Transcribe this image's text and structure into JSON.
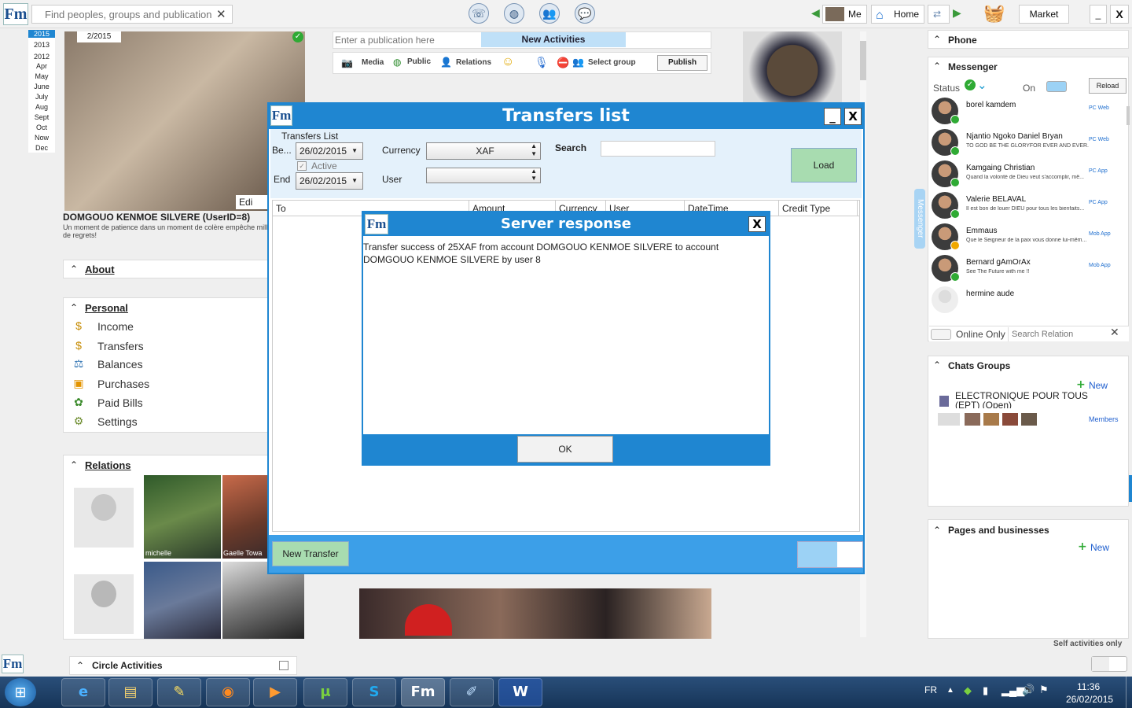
{
  "topbar": {
    "search_placeholder": "Find peoples, groups and publications",
    "search_clear": "✕",
    "me_label": "Me",
    "home_label": "Home",
    "market_label": "Market",
    "min_label": "_",
    "close_label": "X"
  },
  "timeline": {
    "years": [
      "2015",
      "2013",
      "2012"
    ],
    "months": [
      "Apr",
      "May",
      "June",
      "July",
      "Aug",
      "Sept",
      "Oct",
      "Now",
      "Dec"
    ]
  },
  "profile": {
    "date": "2/2015",
    "edit_label": "Edi",
    "name": "DOMGOUO KENMOE SILVERE (UserID=8)",
    "motto": "Un moment de patience dans un moment de colère empêche mill de regrets!",
    "about_label": "About",
    "personal_label": "Personal",
    "menu": [
      {
        "label": "Income",
        "icon": "dollar-coins-icon"
      },
      {
        "label": "Transfers",
        "icon": "dollar-transfer-icon"
      },
      {
        "label": "Balances",
        "icon": "scale-icon"
      },
      {
        "label": "Purchases",
        "icon": "basket-icon"
      },
      {
        "label": "Paid Bills",
        "icon": "bills-icon"
      },
      {
        "label": "Settings",
        "icon": "settings-icon"
      }
    ],
    "relations_label": "Relations",
    "relations": [
      "michelle",
      "Gaelle Towa"
    ]
  },
  "publish": {
    "placeholder": "Enter a publication here",
    "new_activities": "New Activities",
    "media": "Media",
    "public": "Public",
    "relations": "Relations",
    "select_group": "Select group",
    "publish": "Publish"
  },
  "transfers": {
    "title": "Transfers list",
    "section": "Transfers List",
    "begin_label": "Be...",
    "begin_value": "26/02/2015",
    "active_label": "Active",
    "end_label": "End",
    "end_value": "26/02/2015",
    "currency_label": "Currency",
    "currency_value": "XAF",
    "user_label": "User",
    "user_value": "",
    "search_label": "Search",
    "load_label": "Load",
    "columns": [
      "To",
      "Amount",
      "Currency",
      "User",
      "DateTime",
      "Credit Type"
    ],
    "new_transfer": "New Transfer"
  },
  "server": {
    "title": "Server response",
    "close": "X",
    "message": "Transfer success of 25XAF from account DOMGOUO KENMOE SILVERE to account DOMGOUO KENMOE SILVERE by user 8",
    "ok": "OK"
  },
  "right": {
    "phone": "Phone",
    "messenger": "Messenger",
    "status": "Status",
    "on": "On",
    "reload": "Reload",
    "contacts": [
      {
        "name": "borel kamdem",
        "msg": "",
        "app": "PC Web",
        "status": "online"
      },
      {
        "name": "Njantio Ngoko Daniel Bryan",
        "msg": "TO GOD BE THE GLORYFOR EVER AND EVER.",
        "app": "PC Web",
        "status": "online"
      },
      {
        "name": "Kamgaing Christian",
        "msg": "Quand la volonté de Dieu veut s'accomplir, mê...",
        "app": "PC App",
        "status": "online"
      },
      {
        "name": "Valerie BELAVAL",
        "msg": "Il est bon de louer DIEU pour tous les bienfaits...",
        "app": "PC App",
        "status": "online"
      },
      {
        "name": "Emmaus",
        "msg": "Que le Seigneur de la paix vous donne lui-mêm...",
        "app": "Mob App",
        "status": "away"
      },
      {
        "name": "Bernard gAmOrAx",
        "msg": "See The Future with me !!",
        "app": "Mob App",
        "status": "online"
      },
      {
        "name": "hermine aude",
        "msg": "",
        "app": "",
        "status": "none"
      }
    ],
    "online_only": "Online Only",
    "search_relation": "Search Relation",
    "messenger_tab": "Messenger",
    "chats_groups": "Chats Groups",
    "new": "New",
    "group_name": "ELECTRONIQUE POUR TOUS (EPT) (Open)",
    "members": "Members",
    "pages": "Pages and businesses",
    "self_only": "Self activities only"
  },
  "circle": {
    "label": "Circle Activities"
  },
  "taskbar": {
    "lang": "FR",
    "time": "11:36",
    "date": "26/02/2015"
  },
  "colors": {
    "accent": "#1f86d1",
    "load_green": "#a8dcb0",
    "online": "#2faa34"
  }
}
